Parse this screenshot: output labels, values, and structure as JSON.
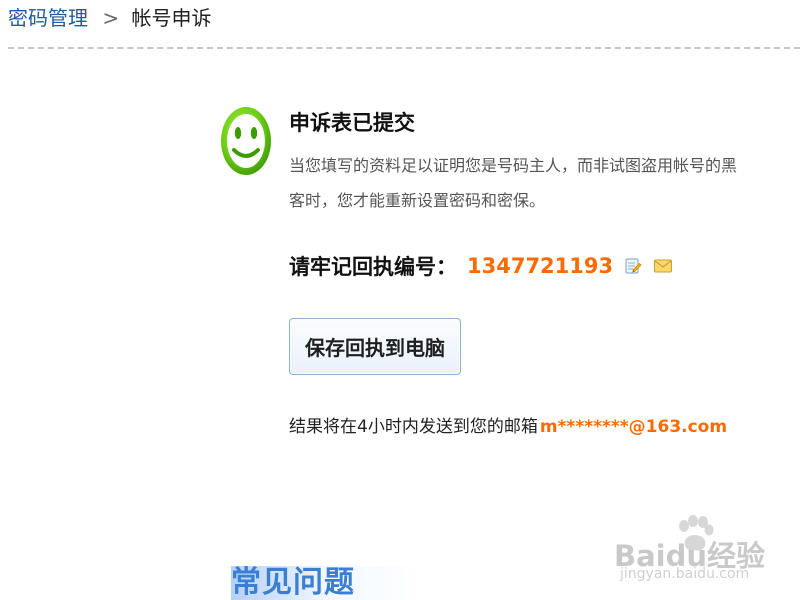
{
  "breadcrumb": {
    "parent": "密码管理",
    "separator": ">",
    "current": "帐号申诉"
  },
  "status": {
    "title": "申诉表已提交",
    "description": "当您填写的资料足以证明您是号码主人，而非试图盗用帐号的黑客时，您才能重新设置密码和密保。",
    "receipt_label": "请牢记回执编号：",
    "receipt_number": "1347721193"
  },
  "actions": {
    "save_receipt": "保存回执到电脑"
  },
  "result": {
    "text": "结果将在4小时内发送到您的邮箱",
    "email": "m********@163.com"
  },
  "faq": {
    "title": "常见问题"
  },
  "watermark": {
    "brand": "Baidu经验",
    "url": "jingyan.baidu.com"
  },
  "icons": {
    "smiley": "smiley-face-icon",
    "edit": "edit-note-icon",
    "mail": "mail-icon",
    "watermark": "paw-logo-icon"
  },
  "colors": {
    "link": "#1f5aa6",
    "accent_orange": "#ff6a00",
    "success_green": "#52b000",
    "faq_blue": "#3a7fd1"
  }
}
